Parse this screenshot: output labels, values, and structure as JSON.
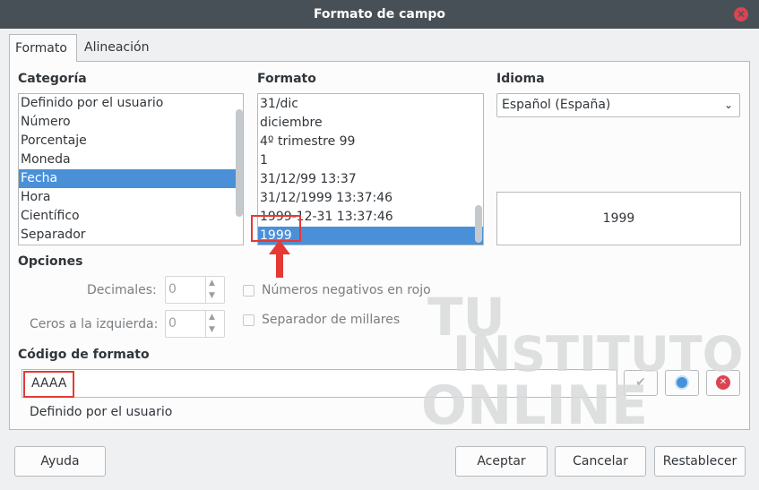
{
  "window": {
    "title": "Formato de campo",
    "close_glyph": "✕"
  },
  "tabs": [
    {
      "label": "Formato",
      "active": true
    },
    {
      "label": "Alineación",
      "active": false
    }
  ],
  "categoria": {
    "title": "Categoría",
    "items": [
      "Definido por el usuario",
      "Número",
      "Porcentaje",
      "Moneda",
      "Fecha",
      "Hora",
      "Científico",
      "Separador"
    ],
    "selected": "Fecha"
  },
  "formato": {
    "title": "Formato",
    "items": [
      "31/dic",
      "diciembre",
      "4º trimestre 99",
      "1",
      "31/12/99 13:37",
      "31/12/1999 13:37:46",
      "1999-12-31 13:37:46",
      "1999"
    ],
    "selected": "1999"
  },
  "idioma": {
    "title": "Idioma",
    "value": "Español (España)",
    "preview": "1999"
  },
  "opciones": {
    "title": "Opciones",
    "decimales_label": "Decimales:",
    "decimales_value": "0",
    "ceros_label": "Ceros a la izquierda:",
    "ceros_value": "0",
    "negativos_label": "Números negativos en rojo",
    "millares_label": "Separador de millares"
  },
  "codigo": {
    "title": "Código de formato",
    "value": "AAAA",
    "description": "Definido por el usuario"
  },
  "watermark": {
    "line1": "TU",
    "line2": "INSTITUTO",
    "line3": "ONLINE"
  },
  "buttons": {
    "ayuda": "Ayuda",
    "aceptar": "Aceptar",
    "cancelar": "Cancelar",
    "restablecer": "Restablecer"
  },
  "colors": {
    "selection": "#4a90d9",
    "highlight": "#e53935",
    "titlebar": "#475057"
  }
}
